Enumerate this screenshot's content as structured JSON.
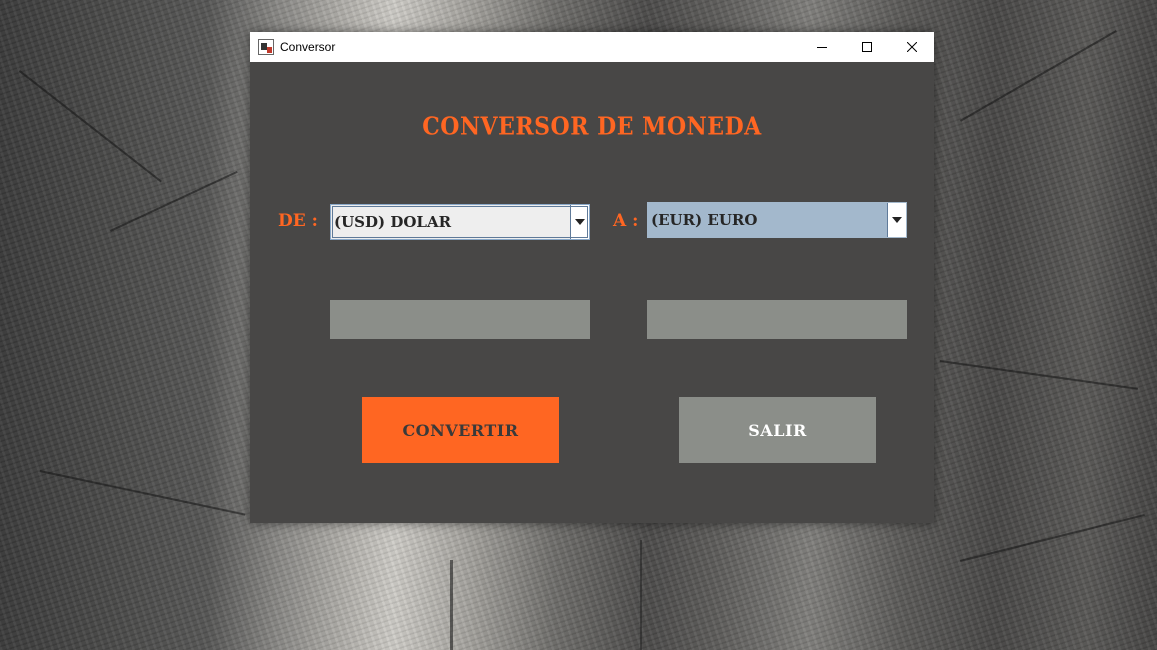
{
  "window": {
    "title": "Conversor",
    "controls": {
      "minimize": "minimize-icon",
      "maximize": "maximize-icon",
      "close": "close-icon"
    }
  },
  "main": {
    "heading": "CONVERSOR DE MONEDA",
    "from_label": "DE :",
    "to_label": "A :",
    "from_currency": "(USD) DOLAR",
    "to_currency": "(EUR) EURO",
    "from_amount": "",
    "to_amount": "",
    "convert_label": "CONVERTIR",
    "exit_label": "SALIR"
  },
  "colors": {
    "accent": "#ff6622",
    "panel_bg": "#484746",
    "field_bg": "#8b8e89",
    "from_combo_bg": "#eeeeee",
    "to_combo_bg": "#a3b8cc",
    "exit_button_bg": "#8b8e89"
  }
}
